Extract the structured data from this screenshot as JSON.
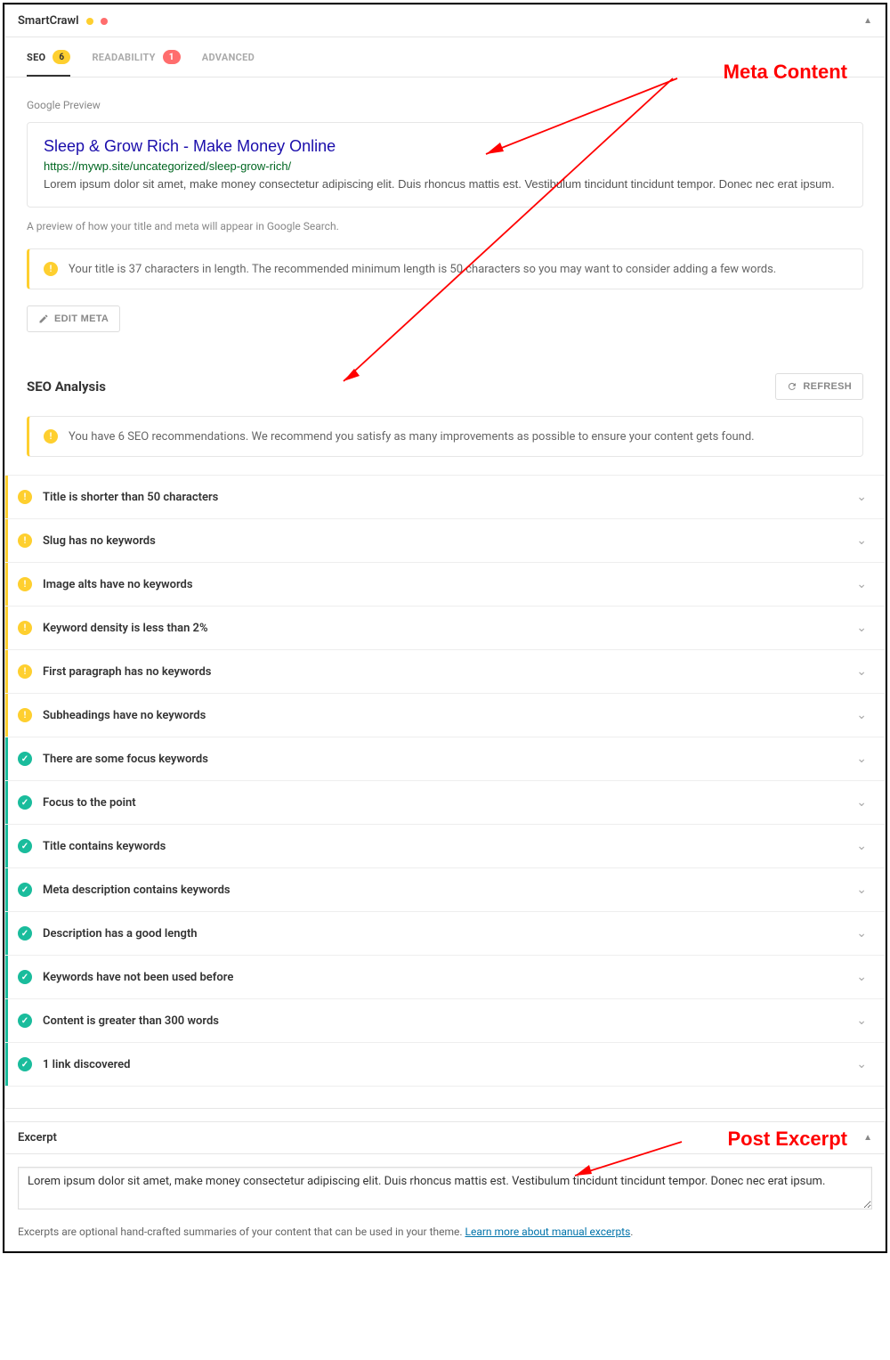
{
  "panel": {
    "title": "SmartCrawl"
  },
  "tabs": {
    "seo": {
      "label": "SEO",
      "count": "6"
    },
    "readability": {
      "label": "READABILITY",
      "count": "1"
    },
    "advanced": {
      "label": "ADVANCED"
    }
  },
  "preview": {
    "label": "Google Preview",
    "title": "Sleep & Grow Rich - Make Money Online",
    "url": "https://mywp.site/uncategorized/sleep-grow-rich/",
    "desc": "Lorem ipsum dolor sit amet, make money consectetur adipiscing elit. Duis rhoncus mattis est. Vestibulum tincidunt tincidunt tempor. Donec nec erat ipsum.",
    "helper": "A preview of how your title and meta will appear in Google Search.",
    "notice": "Your title is 37 characters in length. The recommended minimum length is 50 characters so you may want to consider adding a few words.",
    "edit_btn": "EDIT META"
  },
  "analysis": {
    "title": "SEO Analysis",
    "refresh": "REFRESH",
    "notice": "You have 6 SEO recommendations. We recommend you satisfy as many improvements as possible to ensure your content gets found.",
    "items": [
      {
        "status": "warn",
        "label": "Title is shorter than 50 characters"
      },
      {
        "status": "warn",
        "label": "Slug has no keywords"
      },
      {
        "status": "warn",
        "label": "Image alts have no keywords"
      },
      {
        "status": "warn",
        "label": "Keyword density is less than 2%"
      },
      {
        "status": "warn",
        "label": "First paragraph has no keywords"
      },
      {
        "status": "warn",
        "label": "Subheadings have no keywords"
      },
      {
        "status": "ok",
        "label": "There are some focus keywords"
      },
      {
        "status": "ok",
        "label": "Focus to the point"
      },
      {
        "status": "ok",
        "label": "Title contains keywords"
      },
      {
        "status": "ok",
        "label": "Meta description contains keywords"
      },
      {
        "status": "ok",
        "label": "Description has a good length"
      },
      {
        "status": "ok",
        "label": "Keywords have not been used before"
      },
      {
        "status": "ok",
        "label": "Content is greater than 300 words"
      },
      {
        "status": "ok",
        "label": "1 link discovered"
      }
    ]
  },
  "excerpt": {
    "title": "Excerpt",
    "value": "Lorem ipsum dolor sit amet, make money consectetur adipiscing elit. Duis rhoncus mattis est. Vestibulum tincidunt tincidunt tempor. Donec nec erat ipsum.",
    "help_pre": "Excerpts are optional hand-crafted summaries of your content that can be used in your theme. ",
    "help_link": "Learn more about manual excerpts"
  },
  "annot": {
    "meta": "Meta Content",
    "excerpt": "Post Excerpt"
  }
}
